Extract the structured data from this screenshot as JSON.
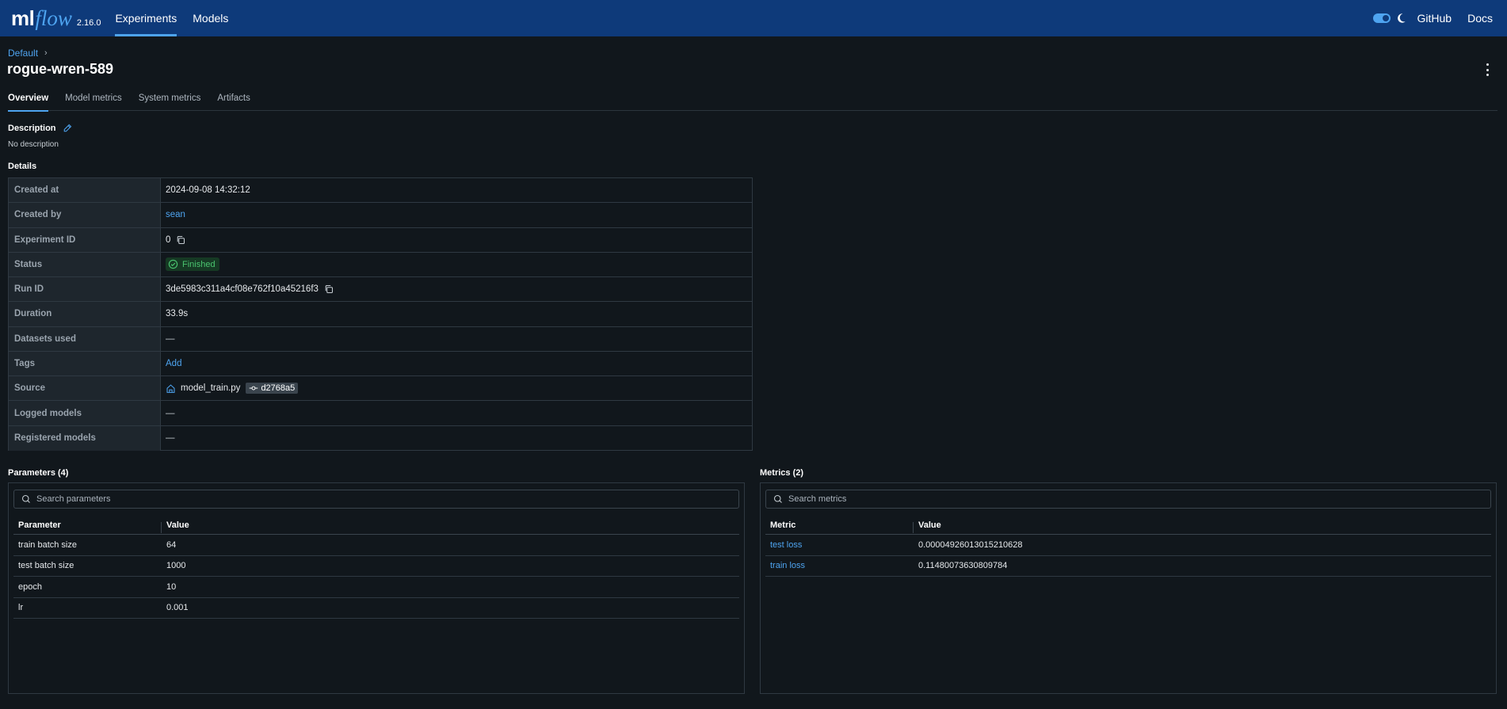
{
  "nav": {
    "logo_ml": "ml",
    "logo_flow": "flow",
    "version": "2.16.0",
    "links": [
      {
        "label": "Experiments",
        "active": true
      },
      {
        "label": "Models",
        "active": false
      }
    ],
    "right_links": [
      "GitHub",
      "Docs"
    ]
  },
  "breadcrumb": {
    "root": "Default"
  },
  "page_title": "rogue-wren-589",
  "tabs": [
    "Overview",
    "Model metrics",
    "System metrics",
    "Artifacts"
  ],
  "description": {
    "label": "Description",
    "value": "No description"
  },
  "details": {
    "label": "Details",
    "created_at_label": "Created at",
    "created_at": "2024-09-08 14:32:12",
    "created_by_label": "Created by",
    "created_by": "sean",
    "experiment_id_label": "Experiment ID",
    "experiment_id": "0",
    "status_label": "Status",
    "status": "Finished",
    "run_id_label": "Run ID",
    "run_id": "3de5983c311a4cf08e762f10a45216f3",
    "duration_label": "Duration",
    "duration": "33.9s",
    "datasets_label": "Datasets used",
    "datasets": "—",
    "tags_label": "Tags",
    "tags_add": "Add",
    "source_label": "Source",
    "source_file": "model_train.py",
    "source_commit": "d2768a5",
    "logged_models_label": "Logged models",
    "logged_models": "—",
    "registered_models_label": "Registered models",
    "registered_models": "—"
  },
  "parameters": {
    "title": "Parameters (4)",
    "search_placeholder": "Search parameters",
    "col_name": "Parameter",
    "col_value": "Value",
    "rows": [
      {
        "name": "train batch size",
        "value": "64"
      },
      {
        "name": "test batch size",
        "value": "1000"
      },
      {
        "name": "epoch",
        "value": "10"
      },
      {
        "name": "lr",
        "value": "0.001"
      }
    ]
  },
  "metrics": {
    "title": "Metrics (2)",
    "search_placeholder": "Search metrics",
    "col_name": "Metric",
    "col_value": "Value",
    "rows": [
      {
        "name": "test loss",
        "value": "0.00004926013015210628"
      },
      {
        "name": "train loss",
        "value": "0.11480073630809784"
      }
    ]
  },
  "colors": {
    "nav_bg": "#0e3a7a",
    "page_bg": "#11171c",
    "accent": "#4ea4f0",
    "status_success": "#4ac46f"
  }
}
